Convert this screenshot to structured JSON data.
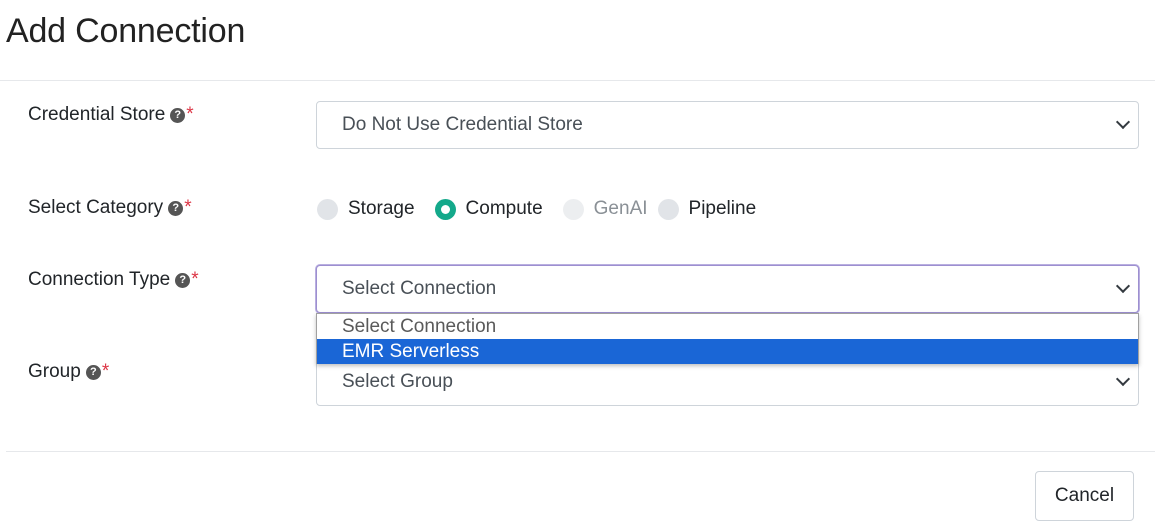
{
  "modal": {
    "title": "Add Connection",
    "cancel_label": "Cancel"
  },
  "fields": {
    "credential_store": {
      "label": "Credential Store",
      "help_icon": "question-circle-icon",
      "required_mark": "*",
      "selected_value": "Do Not Use Credential Store"
    },
    "category": {
      "label": "Select Category",
      "help_icon": "question-circle-icon",
      "required_mark": "*",
      "options": [
        {
          "label": "Storage",
          "checked": false,
          "disabled": false
        },
        {
          "label": "Compute",
          "checked": true,
          "disabled": false
        },
        {
          "label": "GenAI",
          "checked": false,
          "disabled": true
        },
        {
          "label": "Pipeline",
          "checked": false,
          "disabled": false
        }
      ]
    },
    "connection_type": {
      "label": "Connection Type",
      "help_icon": "question-circle-icon",
      "required_mark": "*",
      "selected_value": "Select Connection",
      "dropdown_open": true,
      "options": [
        {
          "label": "Select Connection",
          "highlighted": false
        },
        {
          "label": "EMR Serverless",
          "highlighted": true
        }
      ]
    },
    "group": {
      "label": "Group",
      "help_icon": "question-circle-icon",
      "required_mark": "*",
      "selected_value": "Select Group"
    }
  },
  "colors": {
    "radio_checked": "#14a98b",
    "required": "#dc3545",
    "dropdown_highlight": "#1a66d6"
  }
}
